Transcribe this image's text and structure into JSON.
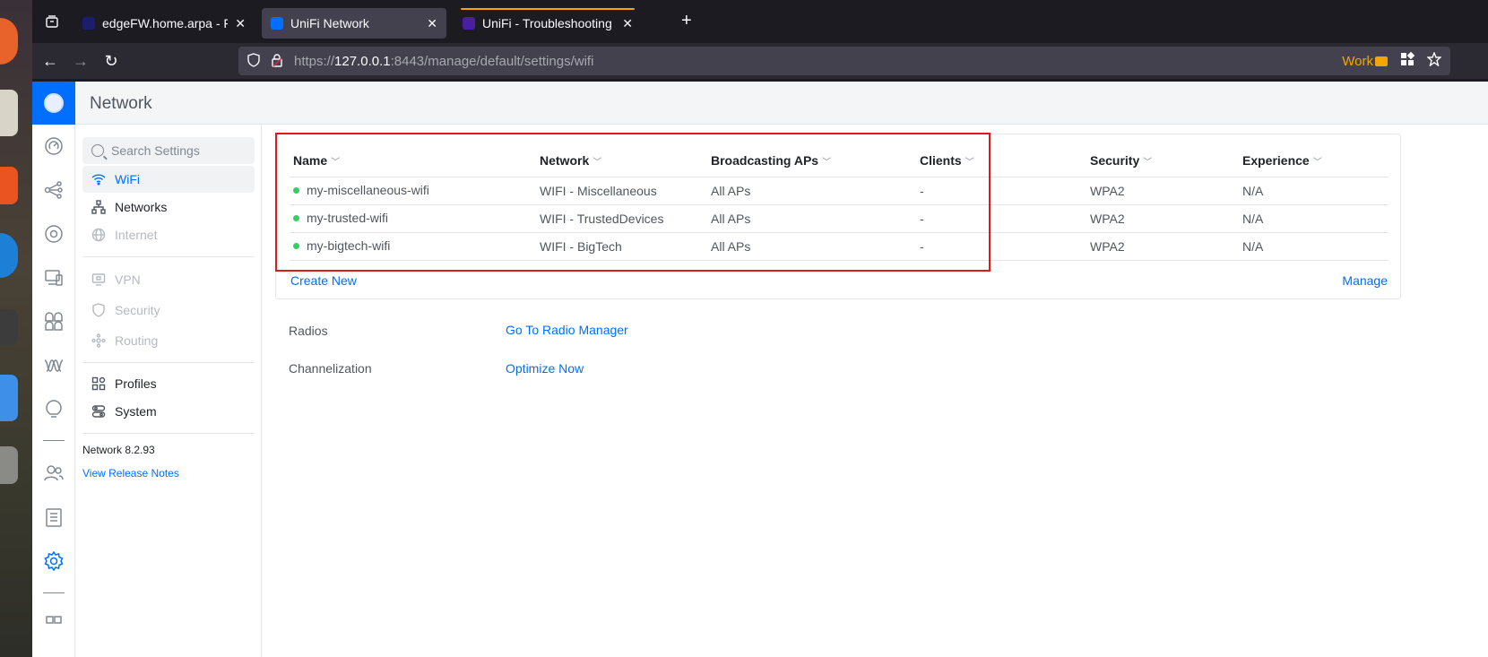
{
  "browser": {
    "tabs": [
      {
        "title": "edgeFW.home.arpa - Firewall",
        "favicon_color": "#1b1f6b",
        "active": false
      },
      {
        "title": "UniFi Network",
        "favicon_color": "#006fff",
        "active": true
      },
      {
        "title": "UniFi - Troubleshooting UniFi",
        "favicon_color": "#4a1ea0",
        "active": false
      }
    ],
    "url_prefix": "https://",
    "url_host": "127.0.0.1",
    "url_rest": ":8443/manage/default/settings/wifi",
    "container_label": "Work",
    "accent": "#f5a500"
  },
  "app": {
    "title": "Network",
    "brand_color": "#006fff"
  },
  "settings_nav": {
    "search_placeholder": "Search Settings",
    "items": [
      {
        "label": "WiFi",
        "icon": "wifi-icon",
        "state": "active"
      },
      {
        "label": "Networks",
        "icon": "networks-icon",
        "state": "normal"
      },
      {
        "label": "Internet",
        "icon": "globe-icon",
        "state": "disabled"
      },
      {
        "label": "VPN",
        "icon": "vpn-icon",
        "state": "disabled"
      },
      {
        "label": "Security",
        "icon": "shield-icon",
        "state": "disabled"
      },
      {
        "label": "Routing",
        "icon": "routing-icon",
        "state": "disabled"
      },
      {
        "label": "Profiles",
        "icon": "profiles-icon",
        "state": "normal"
      },
      {
        "label": "System",
        "icon": "system-icon",
        "state": "normal"
      }
    ],
    "version": "Network 8.2.93",
    "release_notes": "View Release Notes"
  },
  "wifi_table": {
    "columns": [
      "Name",
      "Network",
      "Broadcasting APs",
      "Clients",
      "Security",
      "Experience"
    ],
    "rows": [
      {
        "name": "my-miscellaneous-wifi",
        "network": "WIFI - Miscellaneous",
        "aps": "All APs",
        "clients": "-",
        "security": "WPA2",
        "experience": "N/A"
      },
      {
        "name": "my-trusted-wifi",
        "network": "WIFI - TrustedDevices",
        "aps": "All APs",
        "clients": "-",
        "security": "WPA2",
        "experience": "N/A"
      },
      {
        "name": "my-bigtech-wifi",
        "network": "WIFI - BigTech",
        "aps": "All APs",
        "clients": "-",
        "security": "WPA2",
        "experience": "N/A"
      }
    ],
    "create_new": "Create New",
    "manage": "Manage"
  },
  "radios": {
    "label": "Radios",
    "link": "Go To Radio Manager"
  },
  "channelization": {
    "label": "Channelization",
    "link": "Optimize Now"
  }
}
